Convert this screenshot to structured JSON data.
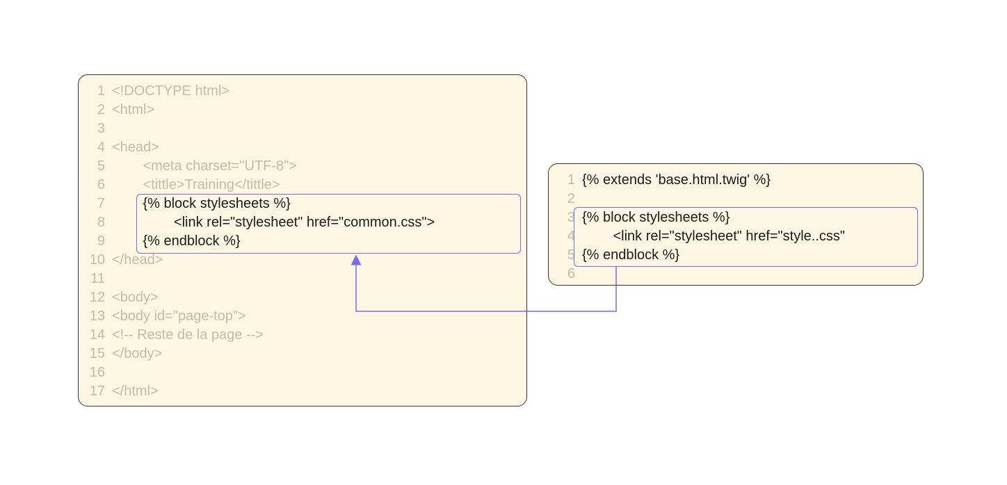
{
  "colors": {
    "panel_bg": "#FDF6E3",
    "border": "#333333",
    "muted_text": "#C2BBA6",
    "dark_text": "#1a1a1a",
    "highlight": "#7B68EE"
  },
  "left_panel": {
    "lines": [
      {
        "num": "1",
        "text": "<!DOCTYPE html>",
        "dark": false,
        "indent": 0
      },
      {
        "num": "2",
        "text": "<html>",
        "dark": false,
        "indent": 0
      },
      {
        "num": "3",
        "text": "",
        "dark": false,
        "indent": 0
      },
      {
        "num": "4",
        "text": "<head>",
        "dark": false,
        "indent": 0
      },
      {
        "num": "5",
        "text": "<meta charset=\"UTF-8\">",
        "dark": false,
        "indent": 2
      },
      {
        "num": "6",
        "text": "<tittle>Training</tittle>",
        "dark": false,
        "indent": 2
      },
      {
        "num": "7",
        "text": "{% block stylesheets %}",
        "dark": true,
        "indent": 2
      },
      {
        "num": "8",
        "text": "<link rel=\"stylesheet\" href=\"common.css\">",
        "dark": true,
        "indent": 4
      },
      {
        "num": "9",
        "text": "{% endblock %}",
        "dark": true,
        "indent": 2
      },
      {
        "num": "10",
        "text": "</head>",
        "dark": false,
        "indent": 0
      },
      {
        "num": "11",
        "text": "",
        "dark": false,
        "indent": 0
      },
      {
        "num": "12",
        "text": "<body>",
        "dark": false,
        "indent": 0
      },
      {
        "num": "13",
        "text": "<body id=\"page-top\">",
        "dark": false,
        "indent": 0
      },
      {
        "num": "14",
        "text": "<!-- Reste de la page -->",
        "dark": false,
        "indent": 0
      },
      {
        "num": "15",
        "text": "</body>",
        "dark": false,
        "indent": 0
      },
      {
        "num": "16",
        "text": "",
        "dark": false,
        "indent": 0
      },
      {
        "num": "17",
        "text": "</html>",
        "dark": false,
        "indent": 0
      }
    ]
  },
  "right_panel": {
    "lines": [
      {
        "num": "1",
        "text": "{% extends 'base.html.twig' %}",
        "dark": true,
        "indent": 0
      },
      {
        "num": "2",
        "text": "",
        "dark": true,
        "indent": 0
      },
      {
        "num": "3",
        "text": "{% block stylesheets %}",
        "dark": true,
        "indent": 0
      },
      {
        "num": "4",
        "text": "<link rel=\"stylesheet\" href=\"style..css\"",
        "dark": true,
        "indent": 2
      },
      {
        "num": "5",
        "text": "{% endblock %}",
        "dark": true,
        "indent": 0
      },
      {
        "num": "6",
        "text": "",
        "dark": true,
        "indent": 0
      }
    ]
  }
}
